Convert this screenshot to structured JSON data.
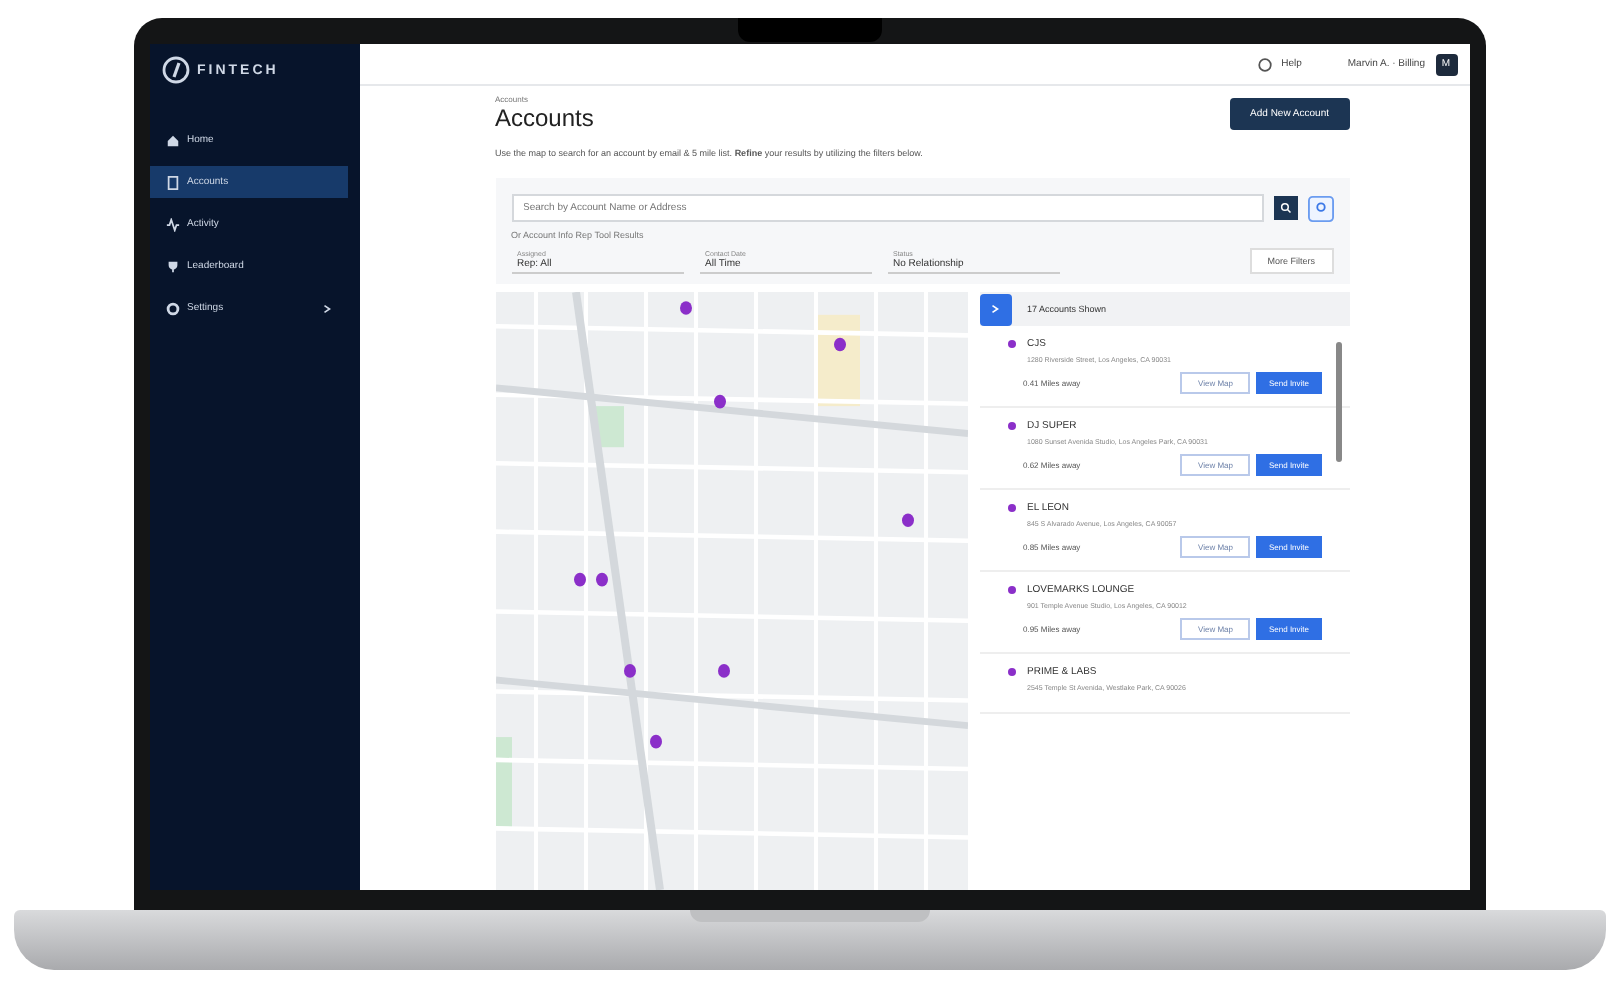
{
  "brand": "FINTECH",
  "sidebar": {
    "items": [
      {
        "label": "Home",
        "selected": false,
        "expandable": false
      },
      {
        "label": "Accounts",
        "selected": true,
        "expandable": false
      },
      {
        "label": "Activity",
        "selected": false,
        "expandable": false
      },
      {
        "label": "Leaderboard",
        "selected": false,
        "expandable": false
      },
      {
        "label": "Settings",
        "selected": false,
        "expandable": true
      }
    ]
  },
  "topbar": {
    "help": "Help",
    "user": "Marvin A. · Billing",
    "avatar": "M"
  },
  "page": {
    "breadcrumb": "Accounts",
    "title": "Accounts",
    "description": "Use the map to search for an account by email & 5 mile list. **Refine** your results by utilizing the filters below.",
    "add_button": "Add New Account"
  },
  "search": {
    "placeholder": "Search by Account Name or Address",
    "note": "Or Account Info Rep Tool Results"
  },
  "filters": [
    {
      "label": "Assigned",
      "value": "Rep: All"
    },
    {
      "label": "Contact Date",
      "value": "All Time"
    },
    {
      "label": "Status",
      "value": "No Relationship"
    }
  ],
  "more_filters": "More Filters",
  "list": {
    "heading": "17 Accounts Shown",
    "accounts": [
      {
        "name": "CJS",
        "address": "1280 Riverside Street, Los Angeles, CA 90031",
        "distance": "0.41 Miles away",
        "map_button": "View Map",
        "invite_button": "Send Invite",
        "color": "#8b2fc9"
      },
      {
        "name": "DJ SUPER",
        "address": "1080 Sunset Avenida Studio, Los Angeles Park, CA 90031",
        "distance": "0.62 Miles away",
        "map_button": "View Map",
        "invite_button": "Send Invite",
        "color": "#8b2fc9"
      },
      {
        "name": "EL LEON",
        "address": "845 S Alvarado Avenue, Los Angeles, CA 90057",
        "distance": "0.85 Miles away",
        "map_button": "View Map",
        "invite_button": "Send Invite",
        "color": "#8b2fc9"
      },
      {
        "name": "LOVEMARKS LOUNGE",
        "address": "901 Temple Avenue Studio, Los Angeles, CA 90012",
        "distance": "0.95 Miles away",
        "map_button": "View Map",
        "invite_button": "Send Invite",
        "color": "#8b2fc9"
      },
      {
        "name": "PRIME & LABS",
        "address": "2545 Temple St Avenida, Westlake Park, CA 90026",
        "color": "#8b2fc9"
      }
    ]
  }
}
